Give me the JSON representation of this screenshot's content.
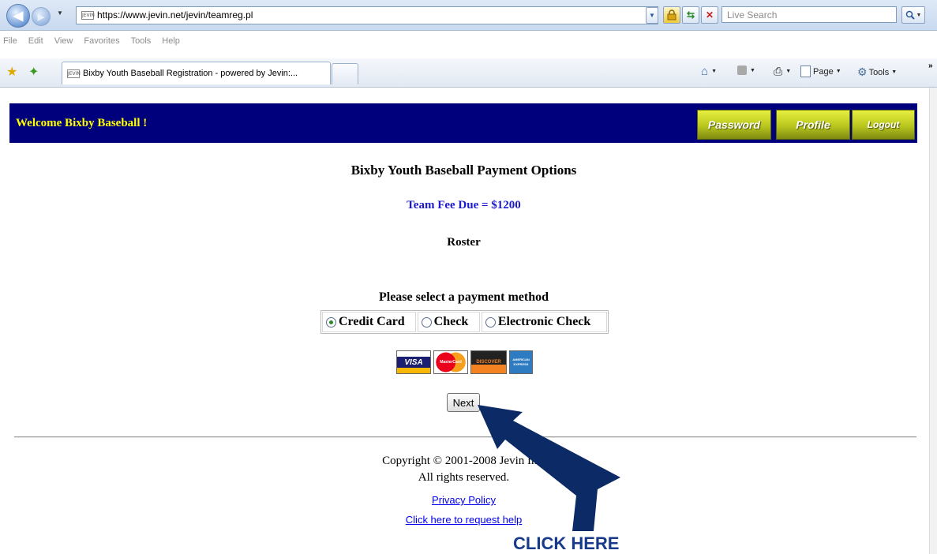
{
  "browser": {
    "url": "https://www.jevin.net/jevin/teamreg.pl",
    "favicon_text": "JEVIN",
    "search_placeholder": "Live Search",
    "menu": [
      "File",
      "Edit",
      "View",
      "Favorites",
      "Tools",
      "Help"
    ],
    "tab_title": "Bixby Youth Baseball Registration - powered by Jevin:...",
    "page_menu_label": "Page",
    "tools_menu_label": "Tools"
  },
  "header": {
    "welcome": "Welcome Bixby Baseball !",
    "buttons": {
      "password": "Password",
      "profile": "Profile",
      "logout": "Logout"
    },
    "banner_color": "#00007c",
    "welcome_color": "#ffff00"
  },
  "main": {
    "title": "Bixby Youth Baseball Payment Options",
    "fee_due": "Team Fee Due = $1200",
    "fee_color": "#1a1acc",
    "roster": "Roster",
    "select_prompt": "Please select a payment method",
    "payment_methods": [
      {
        "label": "Credit Card",
        "selected": true
      },
      {
        "label": "Check",
        "selected": false
      },
      {
        "label": "Electronic Check",
        "selected": false
      }
    ],
    "cards": [
      "VISA",
      "MasterCard",
      "DISCOVER",
      "AMERICAN EXPRESS"
    ],
    "next_label": "Next"
  },
  "footer": {
    "copyright": "Copyright © 2001-2008 Jevin Inc.",
    "rights": "All rights reserved.",
    "privacy_link": "Privacy Policy",
    "help_link": "Click here to request help"
  },
  "annotation": {
    "callout": "CLICK HERE",
    "arrow_color": "#0c2a66"
  }
}
